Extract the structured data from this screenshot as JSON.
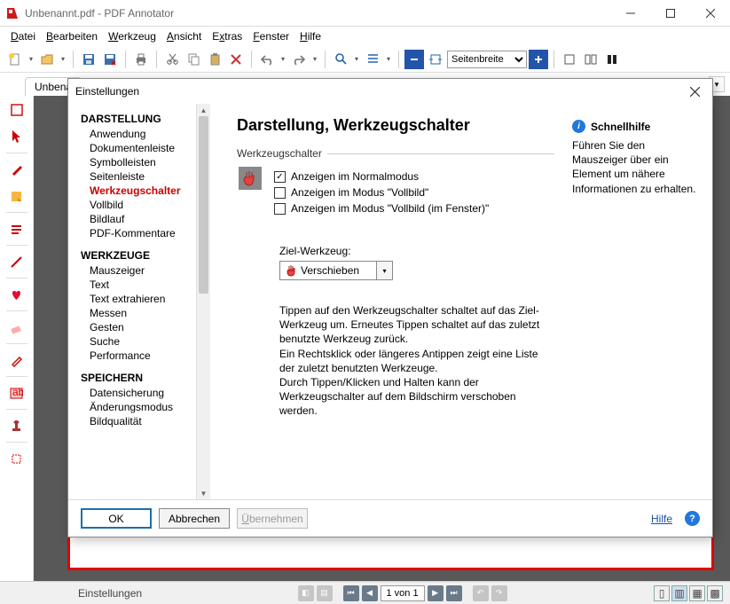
{
  "window": {
    "title": "Unbenannt.pdf - PDF Annotator"
  },
  "menu": {
    "items": [
      "Datei",
      "Bearbeiten",
      "Werkzeug",
      "Ansicht",
      "Extras",
      "Fenster",
      "Hilfe"
    ]
  },
  "toolbar": {
    "zoom_label": "Seitenbreite"
  },
  "tab": {
    "label": "Unbena"
  },
  "tool_label": "Pfeil",
  "status": {
    "left": "Einstellungen",
    "page": "1 von 1"
  },
  "dialog": {
    "title": "Einstellungen",
    "heading": "Darstellung, Werkzeugschalter",
    "nav": {
      "sections": [
        {
          "header": "DARSTELLUNG",
          "items": [
            "Anwendung",
            "Dokumentenleiste",
            "Symbolleisten",
            "Seitenleiste",
            "Werkzeugschalter",
            "Vollbild",
            "Bildlauf",
            "PDF-Kommentare"
          ]
        },
        {
          "header": "WERKZEUGE",
          "items": [
            "Mauszeiger",
            "Text",
            "Text extrahieren",
            "Messen",
            "Gesten",
            "Suche",
            "Performance"
          ]
        },
        {
          "header": "SPEICHERN",
          "items": [
            "Datensicherung",
            "Änderungsmodus",
            "Bildqualität"
          ]
        }
      ],
      "selected": "Werkzeugschalter"
    },
    "group_label": "Werkzeugschalter",
    "checks": [
      {
        "label": "Anzeigen im Normalmodus",
        "checked": true
      },
      {
        "label": "Anzeigen im Modus \"Vollbild\"",
        "checked": false
      },
      {
        "label": "Anzeigen im Modus \"Vollbild (im Fenster)\"",
        "checked": false
      }
    ],
    "target_label": "Ziel-Werkzeug:",
    "target_value": "Verschieben",
    "help_text": "Tippen auf den Werkzeugschalter schaltet auf das Ziel-Werkzeug um. Erneutes Tippen schaltet auf das zuletzt benutzte Werkzeug zurück.\nEin Rechtsklick oder längeres Antippen zeigt eine Liste der zuletzt benutzten Werkzeuge.\nDurch Tippen/Klicken und Halten kann der Werkzeugschalter auf dem Bildschirm verschoben werden.",
    "quickhelp": {
      "title": "Schnellhilfe",
      "text": "Führen Sie den Mauszeiger über ein Element um nähere Informationen zu erhalten."
    },
    "buttons": {
      "ok": "OK",
      "cancel": "Abbrechen",
      "apply": "Übernehmen",
      "help": "Hilfe"
    }
  }
}
